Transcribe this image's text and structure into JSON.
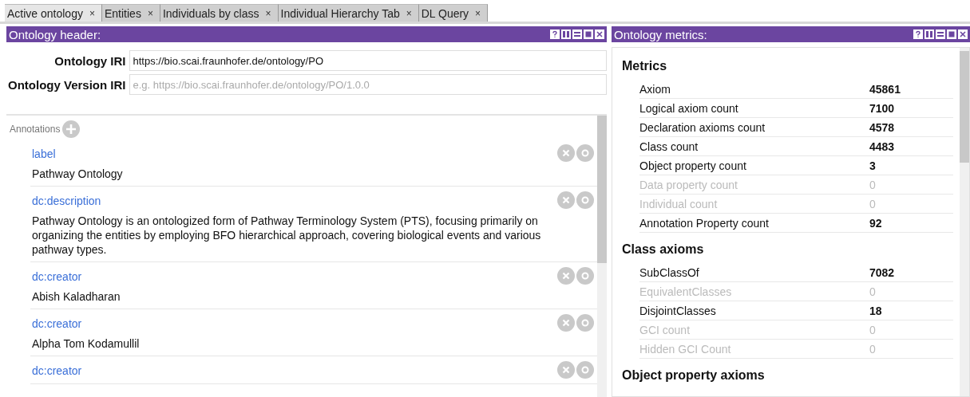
{
  "tabs": [
    {
      "label": "Active ontology",
      "selected": true
    },
    {
      "label": "Entities",
      "selected": false
    },
    {
      "label": "Individuals by class",
      "selected": false
    },
    {
      "label": "Individual Hierarchy Tab",
      "selected": false
    },
    {
      "label": "DL Query",
      "selected": false
    }
  ],
  "close_glyph": "×",
  "header_panel": {
    "title": "Ontology header:",
    "fields": [
      {
        "label": "Ontology IRI",
        "value": "https://bio.scai.fraunhofer.de/ontology/PO"
      },
      {
        "label": "Ontology Version IRI",
        "placeholder": "e.g. https://bio.scai.fraunhofer.de/ontology/PO/1.0.0"
      }
    ],
    "annotations_label": "Annotations",
    "annotations": [
      {
        "property": "label",
        "value": "Pathway Ontology"
      },
      {
        "property": "dc:description",
        "value": "Pathway Ontology is an ontologized form of Pathway Terminology System (PTS), focusing primarily on organizing the entities by employing BFO hierarchical approach, covering biological events and various pathway types."
      },
      {
        "property": "dc:creator",
        "value": "Abish Kaladharan"
      },
      {
        "property": "dc:creator",
        "value": "Alpha Tom Kodamullil"
      },
      {
        "property": "dc:creator"
      }
    ]
  },
  "metrics_panel": {
    "title": "Ontology metrics:",
    "sections": [
      {
        "heading": "Metrics",
        "rows": [
          {
            "name": "Axiom",
            "value": "45861",
            "disabled": false
          },
          {
            "name": "Logical axiom count",
            "value": "7100",
            "disabled": false
          },
          {
            "name": "Declaration axioms count",
            "value": "4578",
            "disabled": false
          },
          {
            "name": "Class count",
            "value": "4483",
            "disabled": false
          },
          {
            "name": "Object property count",
            "value": "3",
            "disabled": false
          },
          {
            "name": "Data property count",
            "value": "0",
            "disabled": true
          },
          {
            "name": "Individual count",
            "value": "0",
            "disabled": true
          },
          {
            "name": "Annotation Property count",
            "value": "92",
            "disabled": false
          }
        ]
      },
      {
        "heading": "Class axioms",
        "rows": [
          {
            "name": "SubClassOf",
            "value": "7082",
            "disabled": false
          },
          {
            "name": "EquivalentClasses",
            "value": "0",
            "disabled": true
          },
          {
            "name": "DisjointClasses",
            "value": "18",
            "disabled": false
          },
          {
            "name": "GCI count",
            "value": "0",
            "disabled": true
          },
          {
            "name": "Hidden GCI Count",
            "value": "0",
            "disabled": true
          }
        ]
      },
      {
        "heading": "Object property axioms"
      }
    ]
  }
}
